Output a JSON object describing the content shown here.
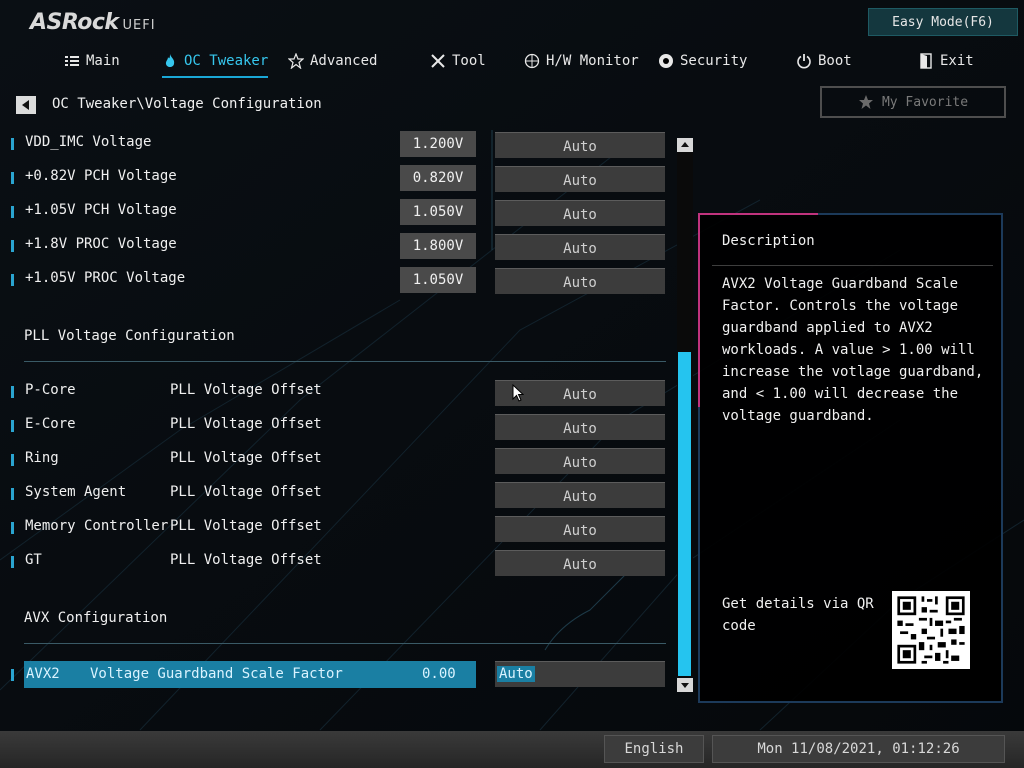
{
  "header": {
    "logo": "ASRock",
    "logo_suffix": "UEFI",
    "easy_mode": "Easy Mode(F6)"
  },
  "nav": {
    "items": [
      {
        "label": "Main",
        "icon": "list-icon"
      },
      {
        "label": "OC Tweaker",
        "icon": "flame-icon",
        "active": true
      },
      {
        "label": "Advanced",
        "icon": "star-icon"
      },
      {
        "label": "Tool",
        "icon": "tools-icon"
      },
      {
        "label": "H/W Monitor",
        "icon": "monitor-icon"
      },
      {
        "label": "Security",
        "icon": "shield-icon"
      },
      {
        "label": "Boot",
        "icon": "power-icon"
      },
      {
        "label": "Exit",
        "icon": "exit-door-icon"
      }
    ]
  },
  "breadcrumb": "OC Tweaker\\Voltage Configuration",
  "favorite": "My Favorite",
  "voltages": [
    {
      "label": "VDD_IMC Voltage",
      "value": "1.200V",
      "setting": "Auto"
    },
    {
      "label": "+0.82V PCH Voltage",
      "value": "0.820V",
      "setting": "Auto"
    },
    {
      "label": "+1.05V PCH Voltage",
      "value": "1.050V",
      "setting": "Auto"
    },
    {
      "label": "+1.8V PROC Voltage",
      "value": "1.800V",
      "setting": "Auto"
    },
    {
      "label": "+1.05V PROC Voltage",
      "value": "1.050V",
      "setting": "Auto"
    }
  ],
  "pll": {
    "title": "PLL Voltage Configuration",
    "items": [
      {
        "label": "P-Core",
        "label2": "PLL Voltage Offset",
        "setting": "Auto"
      },
      {
        "label": "E-Core",
        "label2": "PLL Voltage Offset",
        "setting": "Auto"
      },
      {
        "label": "Ring",
        "label2": "PLL Voltage Offset",
        "setting": "Auto"
      },
      {
        "label": "System Agent",
        "label2": "PLL Voltage Offset",
        "setting": "Auto"
      },
      {
        "label": "Memory Controller",
        "label2": "PLL Voltage Offset",
        "setting": "Auto"
      },
      {
        "label": "GT",
        "label2": "PLL Voltage Offset",
        "setting": "Auto"
      }
    ]
  },
  "avx": {
    "title": "AVX Configuration",
    "selected": {
      "label": "AVX2",
      "label2": "Voltage Guardband Scale Factor",
      "value": "0.00",
      "setting": "Auto"
    }
  },
  "description": {
    "title": "Description",
    "text": "AVX2 Voltage Guardband Scale\nFactor. Controls the voltage\nguardband applied to AVX2\nworkloads. A value > 1.00 will\nincrease the votlage guardband,\nand < 1.00 will decrease the\nvoltage guardband.",
    "qr_text": "Get details via QR code"
  },
  "status": {
    "language": "English",
    "datetime": "Mon 11/08/2021, 01:12:26"
  },
  "colors": {
    "accent": "#25c4ef",
    "selected_row": "#1a7fa3",
    "panel_border_accent": "#c0337e"
  }
}
